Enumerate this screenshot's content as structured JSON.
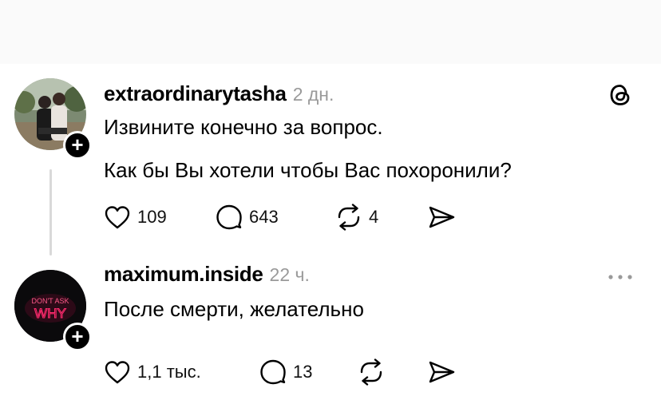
{
  "posts": [
    {
      "username": "extraordinarytasha",
      "time": "2 дн.",
      "lines": [
        "Извините конечно за вопрос.",
        "Как бы Вы хотели чтобы Вас похоронили?"
      ],
      "likes": "109",
      "replies": "643",
      "reposts": "4"
    },
    {
      "username": "maximum.inside",
      "time": "22 ч.",
      "lines": [
        "После смерти, желательно"
      ],
      "avatar_text": [
        "DON'T ASK",
        "WHY"
      ],
      "likes": "1,1 тыс.",
      "replies": "13"
    }
  ],
  "icons": {
    "follow": "+",
    "header_right_post1": "threads-logo-icon",
    "header_right_post2": "more-icon"
  },
  "colors": {
    "accent_neon": "#ff2a6d",
    "muted": "#9a9a9a",
    "divider": "#d9d9d9"
  }
}
